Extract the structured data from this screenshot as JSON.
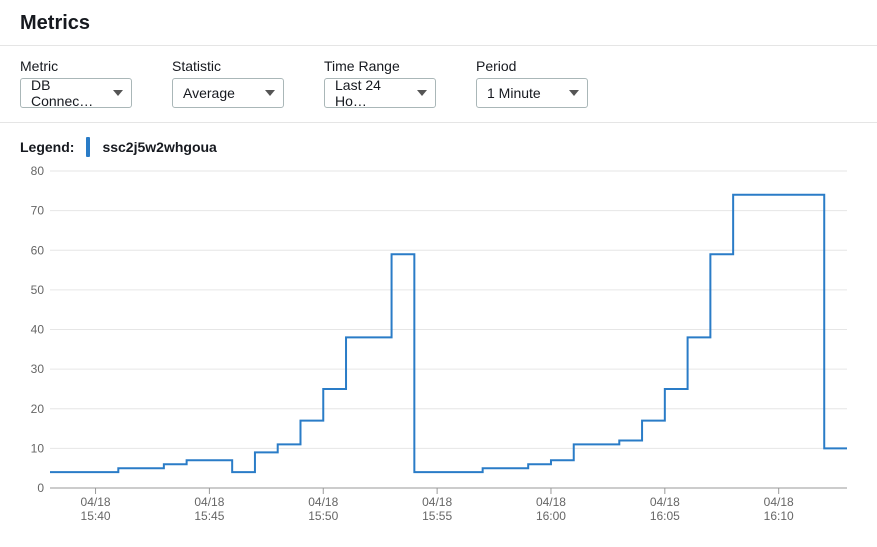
{
  "header": {
    "title": "Metrics"
  },
  "controls": {
    "metric": {
      "label": "Metric",
      "value": "DB Connec…"
    },
    "statistic": {
      "label": "Statistic",
      "value": "Average"
    },
    "timerange": {
      "label": "Time Range",
      "value": "Last 24 Ho…"
    },
    "period": {
      "label": "Period",
      "value": "1 Minute"
    }
  },
  "legend": {
    "label": "Legend:",
    "series_name": "ssc2j5w2whgoua",
    "series_color": "#2a7cc7"
  },
  "chart_data": {
    "type": "line",
    "step": "post",
    "title": "",
    "xlabel": "",
    "ylabel": "",
    "ylim": [
      0,
      80
    ],
    "yticks": [
      0,
      10,
      20,
      30,
      40,
      50,
      60,
      70,
      80
    ],
    "xlim_minutes": [
      938,
      973
    ],
    "xticks": [
      {
        "minute": 940,
        "line1": "04/18",
        "line2": "15:40"
      },
      {
        "minute": 945,
        "line1": "04/18",
        "line2": "15:45"
      },
      {
        "minute": 950,
        "line1": "04/18",
        "line2": "15:50"
      },
      {
        "minute": 955,
        "line1": "04/18",
        "line2": "15:55"
      },
      {
        "minute": 960,
        "line1": "04/18",
        "line2": "16:00"
      },
      {
        "minute": 965,
        "line1": "04/18",
        "line2": "16:05"
      },
      {
        "minute": 970,
        "line1": "04/18",
        "line2": "16:10"
      }
    ],
    "series": [
      {
        "name": "ssc2j5w2whgoua",
        "color": "#2a7cc7",
        "x_minutes": [
          938,
          939,
          940,
          941,
          942,
          943,
          944,
          945,
          946,
          947,
          948,
          949,
          950,
          951,
          952,
          953,
          954,
          955,
          956,
          957,
          958,
          959,
          960,
          961,
          962,
          963,
          964,
          965,
          966,
          967,
          968,
          969,
          970,
          971,
          972
        ],
        "values": [
          4,
          4,
          4,
          5,
          5,
          6,
          7,
          7,
          4,
          9,
          11,
          17,
          25,
          38,
          38,
          59,
          4,
          4,
          4,
          5,
          5,
          6,
          7,
          11,
          11,
          12,
          17,
          25,
          38,
          59,
          74,
          74,
          74,
          74,
          10
        ]
      }
    ]
  }
}
